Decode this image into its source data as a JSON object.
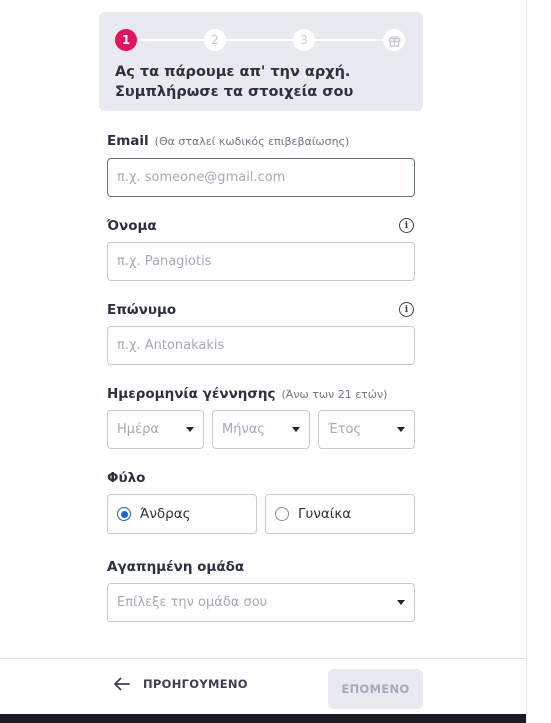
{
  "steps": {
    "items": [
      "1",
      "2",
      "3"
    ],
    "gift_icon": "gift-icon",
    "title_line1": "Ας τα πάρουμε απ' την αρχή.",
    "title_line2": "Συμπλήρωσε τα στοιχεία σου",
    "active_color": "#e1145d"
  },
  "form": {
    "email": {
      "label": "Email",
      "hint": "(Θα σταλεί κωδικός επιβεβαίωσης)",
      "placeholder": "π.χ. someone@gmail.com"
    },
    "first_name": {
      "label": "Όνομα",
      "placeholder": "π.χ. Panagiotis",
      "info": "i"
    },
    "last_name": {
      "label": "Επώνυμο",
      "placeholder": "π.χ. Antonakakis",
      "info": "i"
    },
    "birthdate": {
      "label": "Ημερομηνία γέννησης",
      "hint": "(Άνω των 21 ετών)",
      "day": "Ημέρα",
      "month": "Μήνας",
      "year": "Έτος"
    },
    "gender": {
      "label": "Φύλο",
      "male": "Άνδρας",
      "female": "Γυναίκα",
      "selected": "male"
    },
    "team": {
      "label": "Αγαπημένη ομάδα",
      "placeholder": "Επίλεξε την ομάδα σου"
    }
  },
  "footer": {
    "back_label": "ΠΡΟΗΓΟΥΜΕΝΟ",
    "next_label": "ΕΠΟΜΕΝΟ"
  }
}
